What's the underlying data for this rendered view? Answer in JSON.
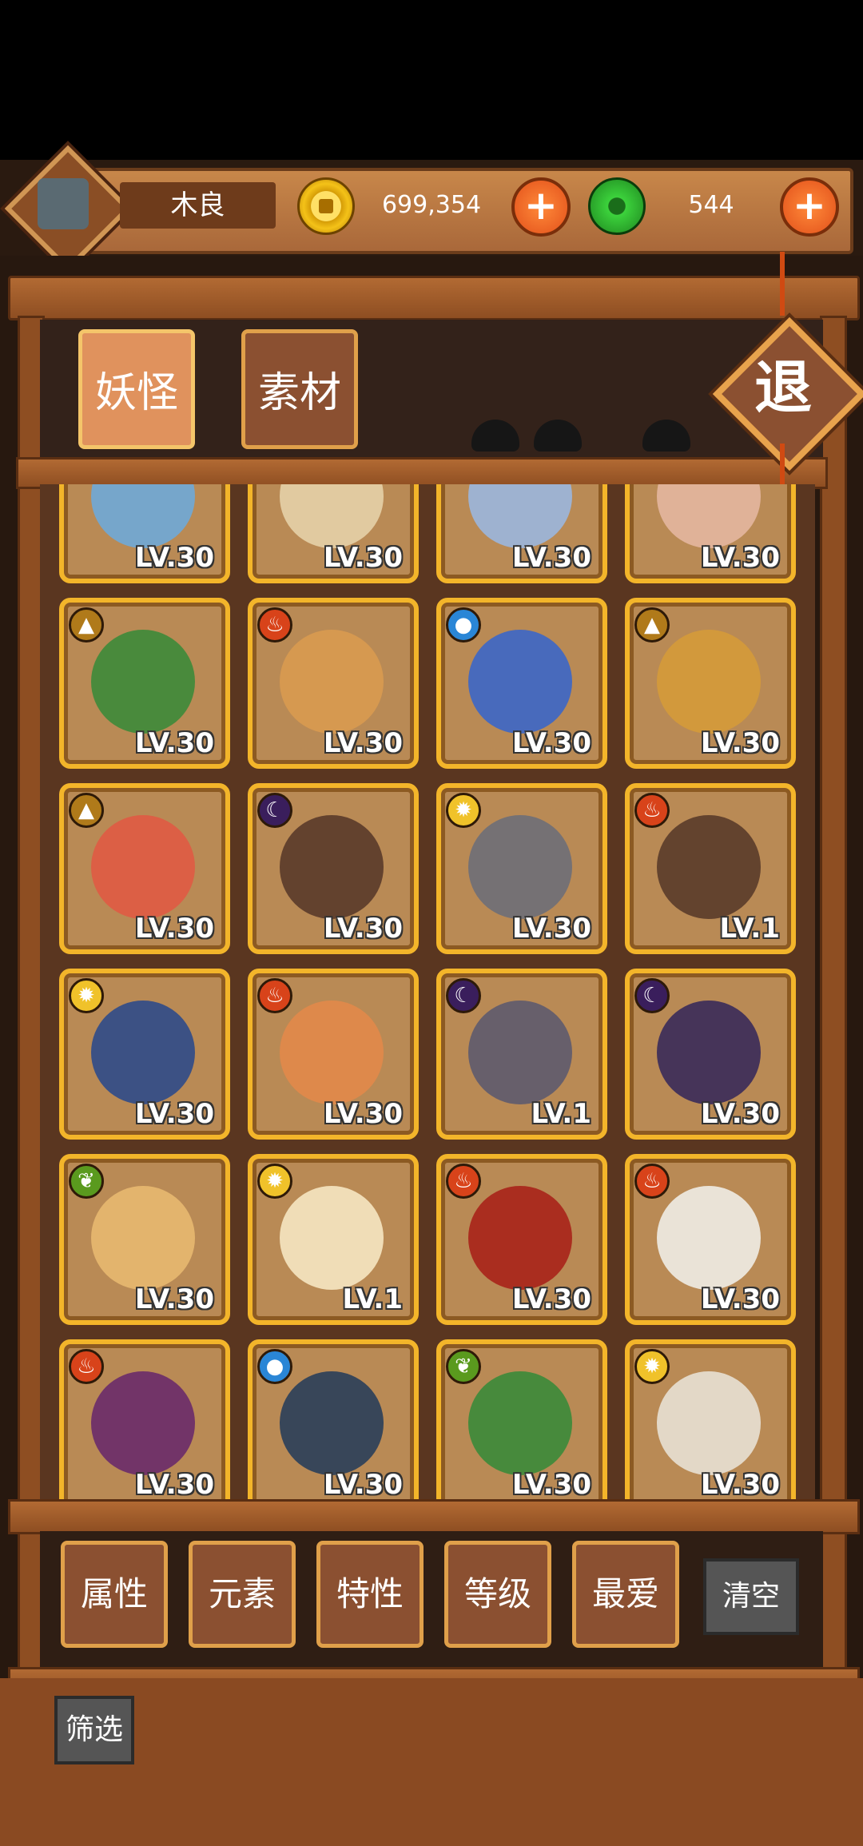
{
  "header": {
    "player_name": "木良",
    "gold": "699,354",
    "jade": "544"
  },
  "tabs": [
    {
      "label": "妖怪",
      "active": true
    },
    {
      "label": "素材",
      "active": false
    }
  ],
  "exit_label": "退",
  "element_colors": {
    "earth": "#b07a1a",
    "fire": "#d8431a",
    "water": "#2a86d6",
    "dark": "#3a1e5c",
    "light": "#f0c22a",
    "wood": "#5a9a1e"
  },
  "cards": [
    {
      "element": "",
      "level": "LV.30",
      "art_color": "#6fa9d8"
    },
    {
      "element": "",
      "level": "LV.30",
      "art_color": "#e6d0a8"
    },
    {
      "element": "",
      "level": "LV.30",
      "art_color": "#9bb6de"
    },
    {
      "element": "",
      "level": "LV.30",
      "art_color": "#e4b6a0"
    },
    {
      "element": "earth",
      "level": "LV.30",
      "art_color": "#3d8a3a"
    },
    {
      "element": "fire",
      "level": "LV.30",
      "art_color": "#d99a50"
    },
    {
      "element": "water",
      "level": "LV.30",
      "art_color": "#3c66c8"
    },
    {
      "element": "earth",
      "level": "LV.30",
      "art_color": "#d59a3a"
    },
    {
      "element": "earth",
      "level": "LV.30",
      "art_color": "#e05a44"
    },
    {
      "element": "dark",
      "level": "LV.30",
      "art_color": "#5a3a2a"
    },
    {
      "element": "light",
      "level": "LV.30",
      "art_color": "#6e6e78"
    },
    {
      "element": "fire",
      "level": "LV.1",
      "art_color": "#5a3b2a"
    },
    {
      "element": "light",
      "level": "LV.30",
      "art_color": "#2f4a8a"
    },
    {
      "element": "fire",
      "level": "LV.30",
      "art_color": "#e2884a"
    },
    {
      "element": "dark",
      "level": "LV.1",
      "art_color": "#5e5a6e"
    },
    {
      "element": "dark",
      "level": "LV.30",
      "art_color": "#3a2a5a"
    },
    {
      "element": "wood",
      "level": "LV.30",
      "art_color": "#e8b870"
    },
    {
      "element": "light",
      "level": "LV.1",
      "art_color": "#f6e6c2"
    },
    {
      "element": "fire",
      "level": "LV.30",
      "art_color": "#a8221a"
    },
    {
      "element": "fire",
      "level": "LV.30",
      "art_color": "#f0ece6"
    },
    {
      "element": "fire",
      "level": "LV.30",
      "art_color": "#6a2a6a"
    },
    {
      "element": "water",
      "level": "LV.30",
      "art_color": "#2a3e5a"
    },
    {
      "element": "wood",
      "level": "LV.30",
      "art_color": "#3b8a3a"
    },
    {
      "element": "light",
      "level": "LV.30",
      "art_color": "#e8e0d4"
    }
  ],
  "filters": [
    {
      "label": "属性"
    },
    {
      "label": "元素"
    },
    {
      "label": "特性"
    },
    {
      "label": "等级"
    },
    {
      "label": "最爱"
    }
  ],
  "clear_label": "清空",
  "sift_label": "筛选"
}
